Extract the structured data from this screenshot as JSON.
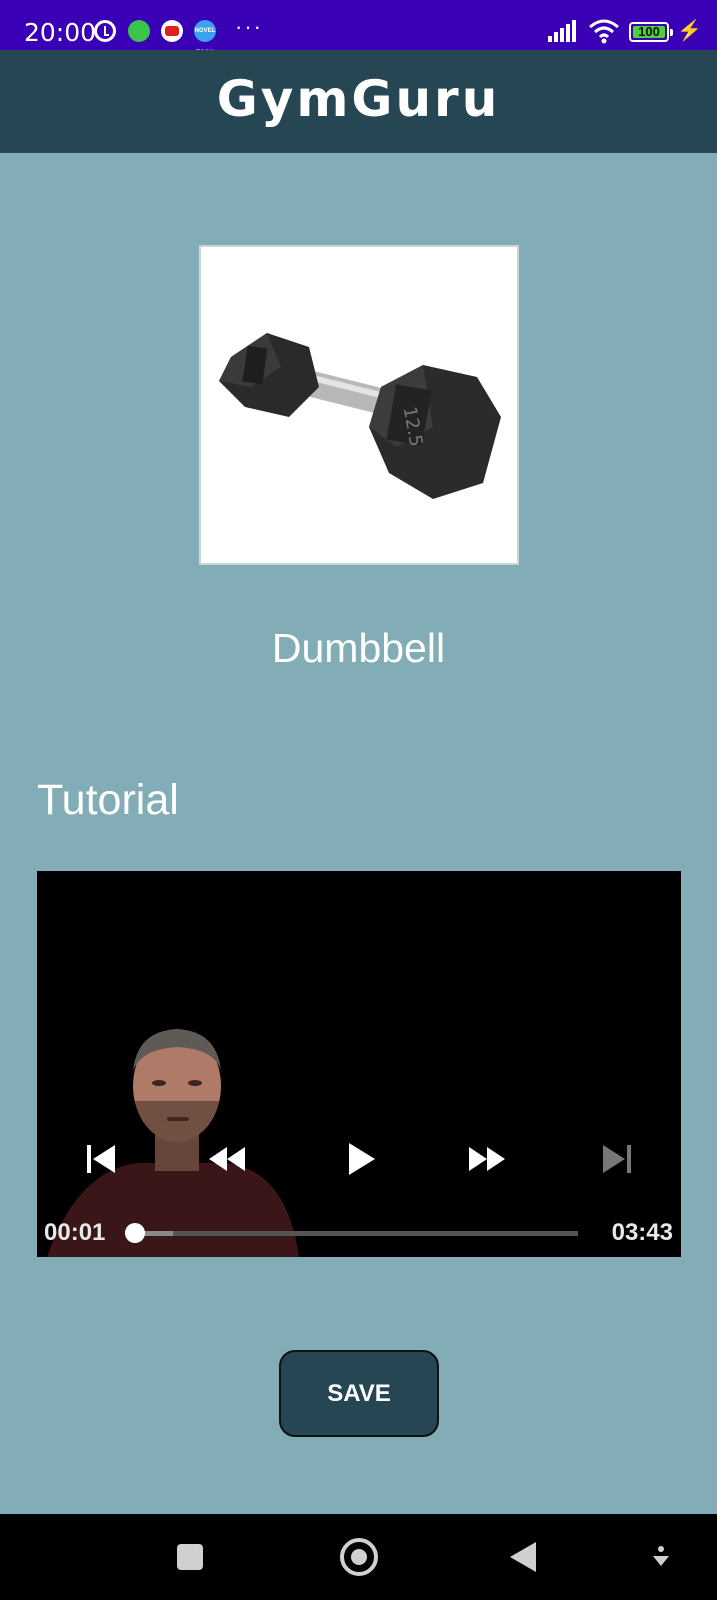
{
  "status_bar": {
    "time": "20:00",
    "battery": "100",
    "icons": [
      "alarm-icon",
      "app-notification-icon",
      "youtube-icon",
      "novel-toon-icon",
      "more-icon",
      "signal-icon",
      "wifi-icon",
      "battery-icon",
      "charging-icon"
    ],
    "novel_icon_text": "NOVEL TOON"
  },
  "app_bar": {
    "title": "GymGuru",
    "color": "#264653"
  },
  "equipment": {
    "name": "Dumbbell",
    "weight_marking": "12.5"
  },
  "tutorial": {
    "section_title": "Tutorial",
    "current_time": "00:01",
    "total_time": "03:43",
    "progress_fraction": 0.004,
    "buffered_fraction": 0.09,
    "controls": [
      "skip-previous-icon",
      "rewind-icon",
      "play-icon",
      "fast-forward-icon",
      "skip-next-icon"
    ]
  },
  "save_label": "SAVE",
  "background_color": "#82adb6",
  "nav_bar": {
    "icons": [
      "recents-icon",
      "home-icon",
      "back-icon",
      "menu-icon"
    ]
  }
}
